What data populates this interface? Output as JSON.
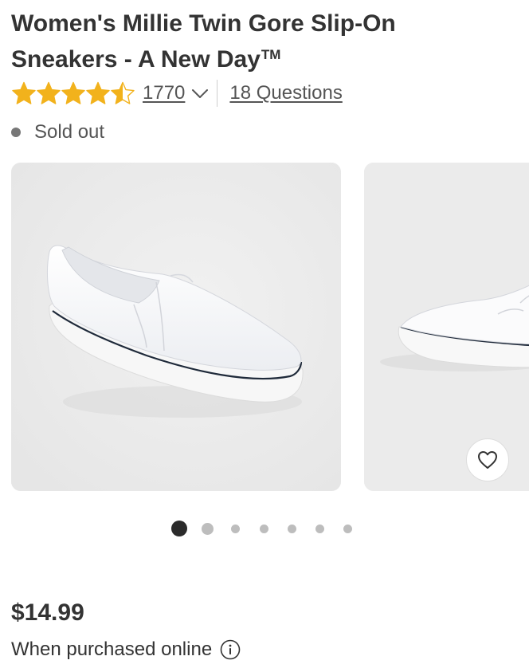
{
  "product": {
    "title_line1": "Women's Millie Twin Gore Slip-On",
    "title_line2": "Sneakers - A New Day",
    "title_trademark": "TM"
  },
  "rating": {
    "stars_value": 4.5,
    "stars_max": 5,
    "star_color": "#F2B21C",
    "review_count": "1770",
    "questions_link": "18 Questions"
  },
  "availability": {
    "status": "Sold out",
    "dot_color": "#777777"
  },
  "gallery": {
    "image_count": 7,
    "active_index": 0,
    "favorite_icon": "heart-icon",
    "background_color": "#EAEAEA"
  },
  "pricing": {
    "price": "$14.99",
    "note": "When purchased online",
    "info_icon": "info-icon"
  }
}
